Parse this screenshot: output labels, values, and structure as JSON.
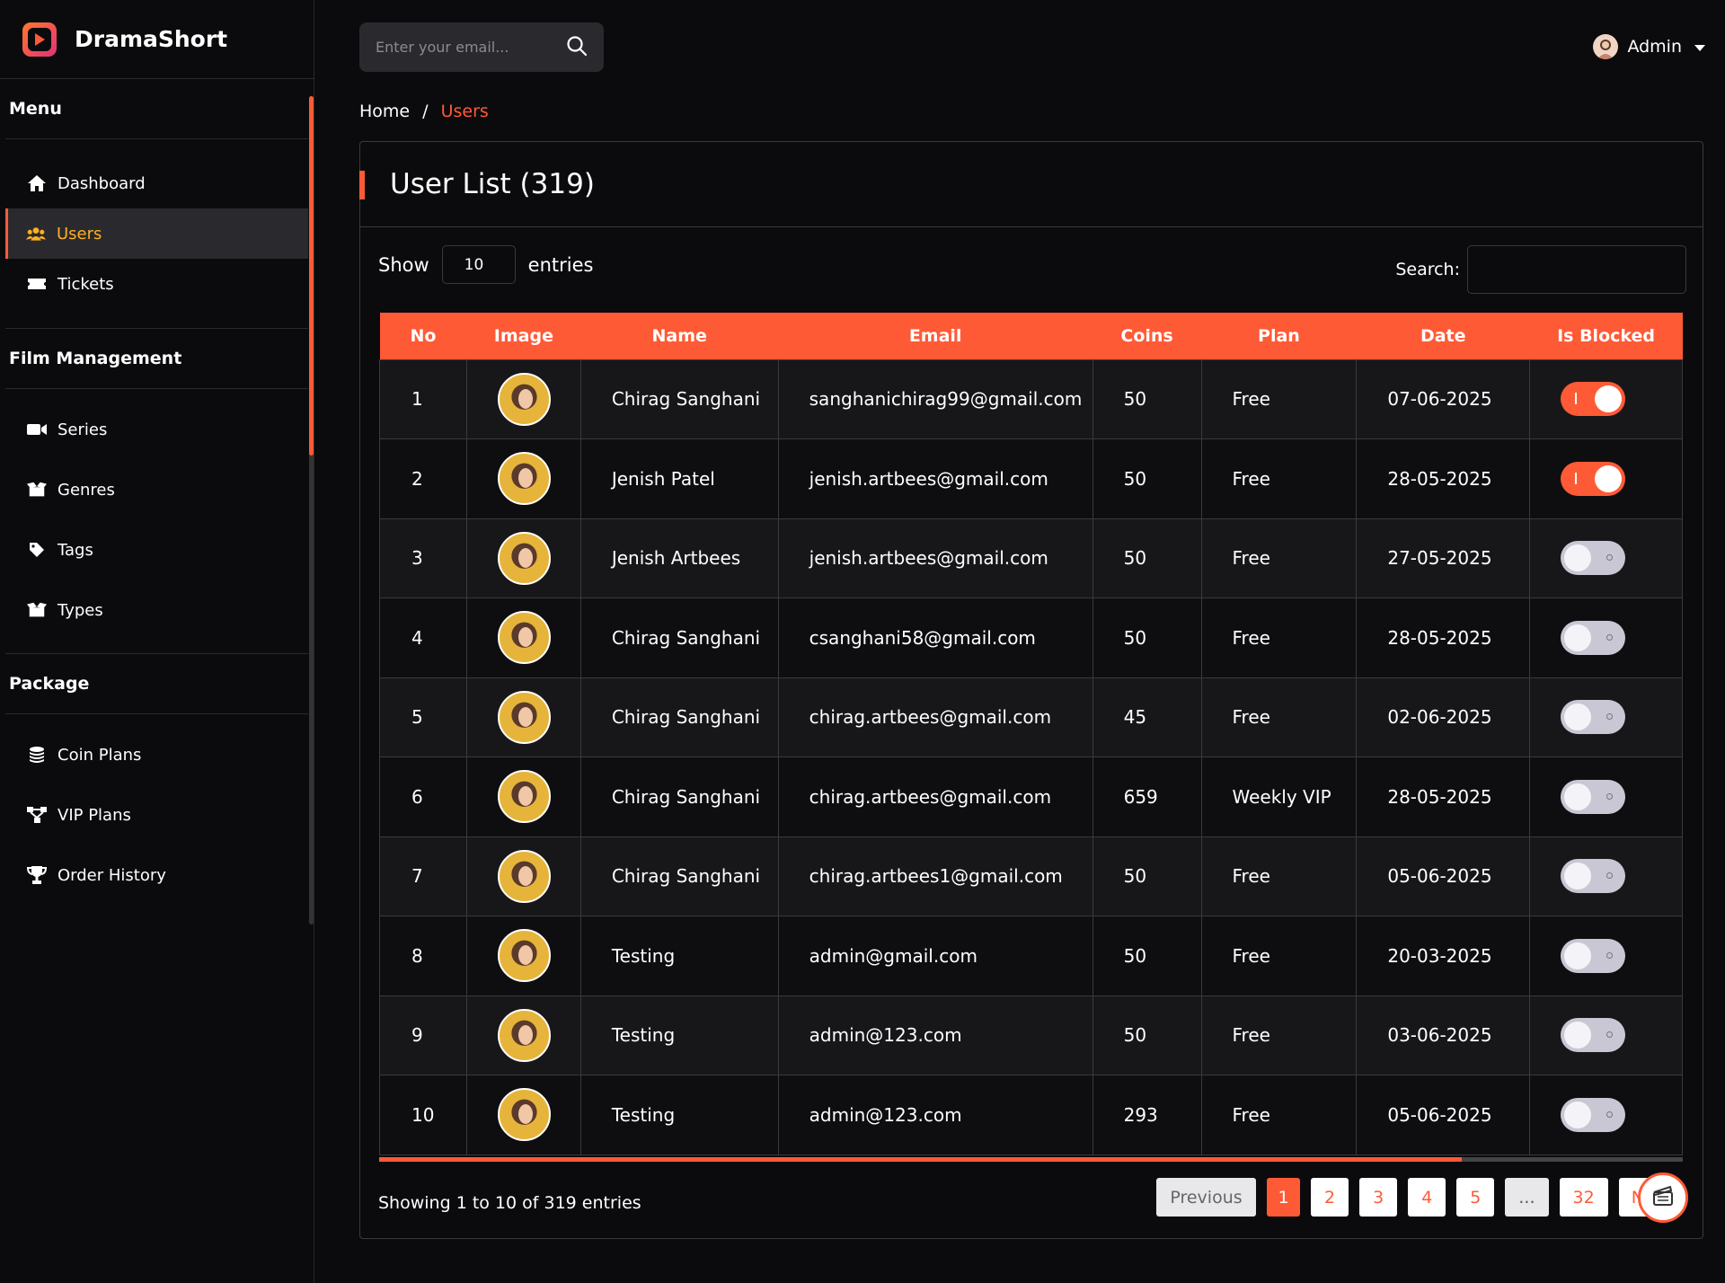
{
  "app": {
    "name": "DramaShort"
  },
  "sidebar": {
    "sections": [
      {
        "title": "Menu",
        "items": [
          {
            "label": "Dashboard",
            "icon": "home-icon"
          },
          {
            "label": "Users",
            "icon": "users-icon",
            "active": true
          },
          {
            "label": "Tickets",
            "icon": "ticket-icon"
          }
        ]
      },
      {
        "title": "Film Management",
        "items": [
          {
            "label": "Series",
            "icon": "video-icon"
          },
          {
            "label": "Genres",
            "icon": "box-icon"
          },
          {
            "label": "Tags",
            "icon": "tag-icon"
          },
          {
            "label": "Types",
            "icon": "box-icon"
          }
        ]
      },
      {
        "title": "Package",
        "items": [
          {
            "label": "Coin Plans",
            "icon": "coins-icon"
          },
          {
            "label": "VIP Plans",
            "icon": "network-icon"
          },
          {
            "label": "Order History",
            "icon": "trophy-icon"
          }
        ]
      }
    ]
  },
  "header": {
    "search_placeholder": "Enter your email...",
    "user": "Admin"
  },
  "breadcrumb": {
    "home": "Home",
    "sep": "/",
    "current": "Users"
  },
  "card": {
    "title": "User List (319)"
  },
  "controls": {
    "show": "Show",
    "length": "10",
    "entries": "entries",
    "search_label": "Search:"
  },
  "table": {
    "columns": [
      "No",
      "Image",
      "Name",
      "Email",
      "Coins",
      "Plan",
      "Date",
      "Is Blocked"
    ],
    "rows": [
      {
        "no": "1",
        "name": "Chirag Sanghani",
        "email": "sanghanichirag99@gmail.com",
        "coins": "50",
        "plan": "Free",
        "date": "07-06-2025",
        "blocked": true
      },
      {
        "no": "2",
        "name": "Jenish Patel",
        "email": "jenish.artbees@gmail.com",
        "coins": "50",
        "plan": "Free",
        "date": "28-05-2025",
        "blocked": true
      },
      {
        "no": "3",
        "name": "Jenish Artbees",
        "email": "jenish.artbees@gmail.com",
        "coins": "50",
        "plan": "Free",
        "date": "27-05-2025",
        "blocked": false
      },
      {
        "no": "4",
        "name": "Chirag Sanghani",
        "email": "csanghani58@gmail.com",
        "coins": "50",
        "plan": "Free",
        "date": "28-05-2025",
        "blocked": false
      },
      {
        "no": "5",
        "name": "Chirag Sanghani",
        "email": "chirag.artbees@gmail.com",
        "coins": "45",
        "plan": "Free",
        "date": "02-06-2025",
        "blocked": false
      },
      {
        "no": "6",
        "name": "Chirag Sanghani",
        "email": "chirag.artbees@gmail.com",
        "coins": "659",
        "plan": "Weekly VIP",
        "date": "28-05-2025",
        "blocked": false
      },
      {
        "no": "7",
        "name": "Chirag Sanghani",
        "email": "chirag.artbees1@gmail.com",
        "coins": "50",
        "plan": "Free",
        "date": "05-06-2025",
        "blocked": false
      },
      {
        "no": "8",
        "name": "Testing",
        "email": "admin@gmail.com",
        "coins": "50",
        "plan": "Free",
        "date": "20-03-2025",
        "blocked": false
      },
      {
        "no": "9",
        "name": "Testing",
        "email": "admin@123.com",
        "coins": "50",
        "plan": "Free",
        "date": "03-06-2025",
        "blocked": false
      },
      {
        "no": "10",
        "name": "Testing",
        "email": "admin@123.com",
        "coins": "293",
        "plan": "Free",
        "date": "05-06-2025",
        "blocked": false
      }
    ]
  },
  "footer": {
    "info": "Showing 1 to 10 of 319 entries",
    "pager": {
      "prev": "Previous",
      "pages": [
        "1",
        "2",
        "3",
        "4",
        "5",
        "...",
        "32"
      ],
      "next": "Next"
    }
  },
  "colors": {
    "accent": "#ff5a36",
    "active_nav_text": "#ffb020",
    "background": "#0b0b0d"
  }
}
